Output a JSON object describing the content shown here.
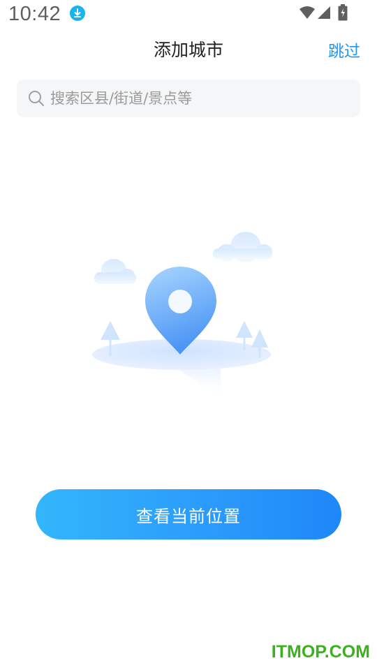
{
  "status_bar": {
    "time": "10:42",
    "icons": [
      "download-icon",
      "wifi-icon",
      "signal-icon",
      "battery-icon"
    ]
  },
  "header": {
    "title": "添加城市",
    "skip_label": "跳过"
  },
  "search": {
    "placeholder": "搜索区县/街道/景点等",
    "value": "",
    "icon": "search-icon"
  },
  "illustration": {
    "icon": "location-pin-illustration"
  },
  "action": {
    "locate_label": "查看当前位置"
  },
  "watermark": {
    "text": "ITMOP.COM"
  },
  "colors": {
    "accent": "#2196f3",
    "button_gradient_start": "#33b6fb",
    "button_gradient_end": "#1e87f7",
    "watermark": "#3bb21d"
  }
}
